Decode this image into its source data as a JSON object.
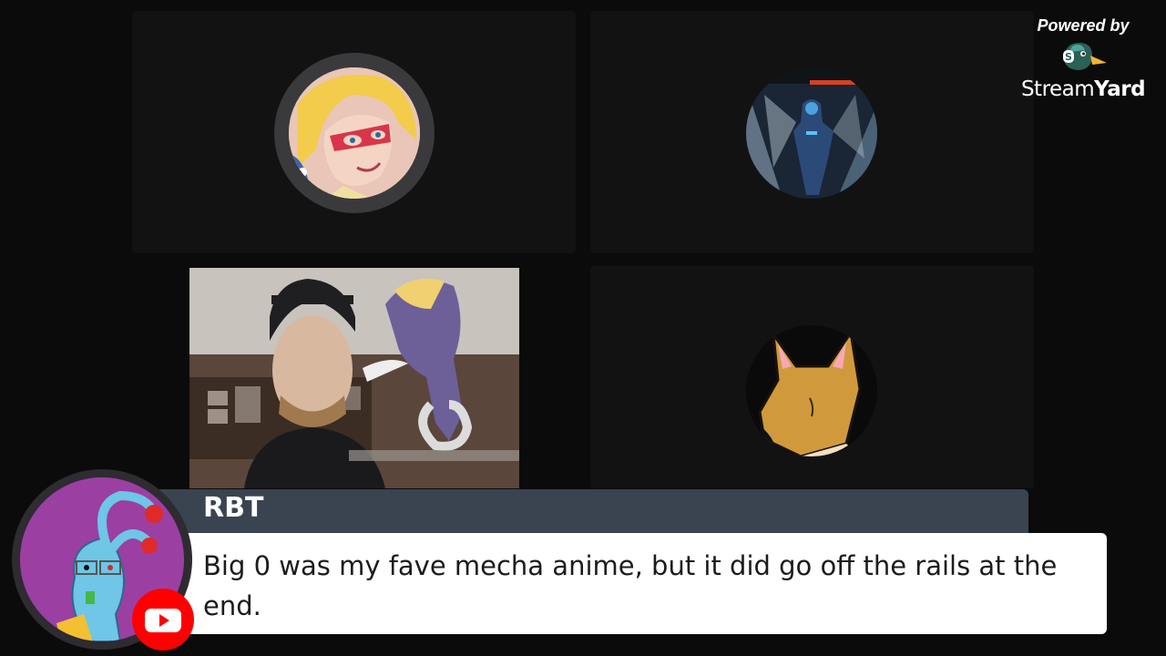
{
  "branding": {
    "powered_by": "Powered by",
    "name_part1": "Stream",
    "name_part2": "Yard"
  },
  "participants": [
    {
      "icon": "hero-avatar-icon"
    },
    {
      "icon": "armored-figure-avatar-icon"
    },
    {
      "icon": "webcam-feed"
    },
    {
      "icon": "fox-avatar-icon"
    }
  ],
  "comment": {
    "author": "RBT",
    "text": "Big 0 was my fave mecha anime, but it did go off the rails at the end.",
    "platform_icon": "youtube-icon",
    "colors": {
      "header": "#3a4350",
      "body": "#ffffff",
      "youtube": "#ff0000"
    }
  }
}
